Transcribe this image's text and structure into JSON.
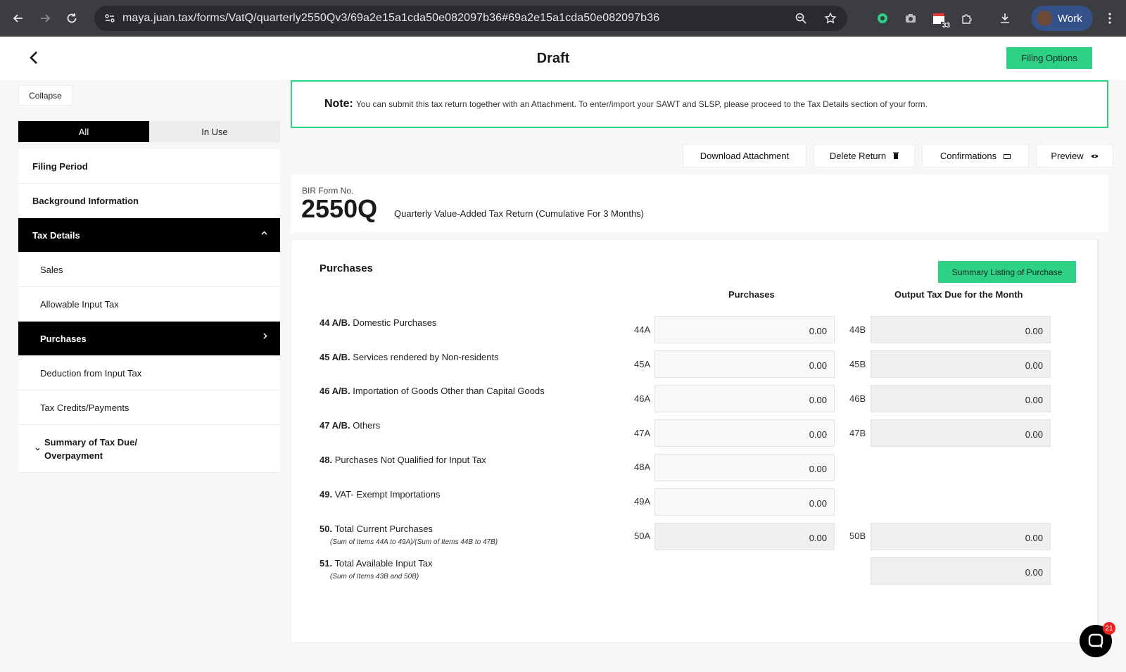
{
  "browser": {
    "url": "maya.juan.tax/forms/VatQ/quarterly2550Qv3/69a2e15a1cda50e082097b36#69a2e15a1cda50e082097b36",
    "calendar_badge": "33",
    "profile_label": "Work"
  },
  "header": {
    "title": "Draft",
    "filing_options": "Filing Options"
  },
  "sidebar": {
    "collapse": "Collapse",
    "tabs": [
      "All",
      "In Use"
    ],
    "items": [
      {
        "label": "Filing Period"
      },
      {
        "label": "Background Information"
      },
      {
        "label": "Tax Details"
      },
      {
        "label": "Sales"
      },
      {
        "label": "Allowable Input Tax"
      },
      {
        "label": "Purchases"
      },
      {
        "label": "Deduction from Input Tax"
      },
      {
        "label": "Tax Credits/Payments"
      },
      {
        "label_line1": "Summary of Tax Due/",
        "label_line2": "Overpayment"
      }
    ]
  },
  "note": {
    "label": "Note:",
    "text": "You can submit this tax return together with an Attachment. To enter/import your SAWT and SLSP, please proceed to the Tax Details section of your form."
  },
  "actions": {
    "download": "Download Attachment",
    "delete": "Delete Return",
    "confirmations": "Confirmations",
    "preview": "Preview"
  },
  "form": {
    "bir_label": "BIR Form No.",
    "number": "2550Q",
    "description": "Quarterly Value-Added Tax Return (Cumulative For 3 Months)"
  },
  "purchases": {
    "title": "Purchases",
    "summary_button": "Summary Listing of Purchase",
    "col_purchases": "Purchases",
    "col_output": "Output Tax Due for the Month",
    "rows": [
      {
        "num": "44 A/B.",
        "label": "Domestic Purchases",
        "codeA": "44A",
        "valA": "0.00",
        "codeB": "44B",
        "valB": "0.00"
      },
      {
        "num": "45 A/B.",
        "label": "Services rendered by Non-residents",
        "codeA": "45A",
        "valA": "0.00",
        "codeB": "45B",
        "valB": "0.00"
      },
      {
        "num": "46 A/B.",
        "label": "Importation of Goods Other than Capital Goods",
        "codeA": "46A",
        "valA": "0.00",
        "codeB": "46B",
        "valB": "0.00"
      },
      {
        "num": "47 A/B.",
        "label": "Others",
        "codeA": "47A",
        "valA": "0.00",
        "codeB": "47B",
        "valB": "0.00"
      },
      {
        "num": "48.",
        "label": "Purchases Not Qualified for Input Tax",
        "codeA": "48A",
        "valA": "0.00"
      },
      {
        "num": "49.",
        "label": "VAT- Exempt Importations",
        "codeA": "49A",
        "valA": "0.00"
      },
      {
        "num": "50.",
        "label": "Total Current Purchases",
        "sub": "(Sum of Items 44A to 49A)/(Sum of Items 44B to 47B)",
        "codeA": "50A",
        "valA": "0.00",
        "codeB": "50B",
        "valB": "0.00"
      },
      {
        "num": "51.",
        "label": "Total Available Input Tax",
        "sub": "(Sum of Items 43B and 50B)",
        "valB": "0.00"
      }
    ]
  },
  "chat": {
    "badge": "21"
  }
}
